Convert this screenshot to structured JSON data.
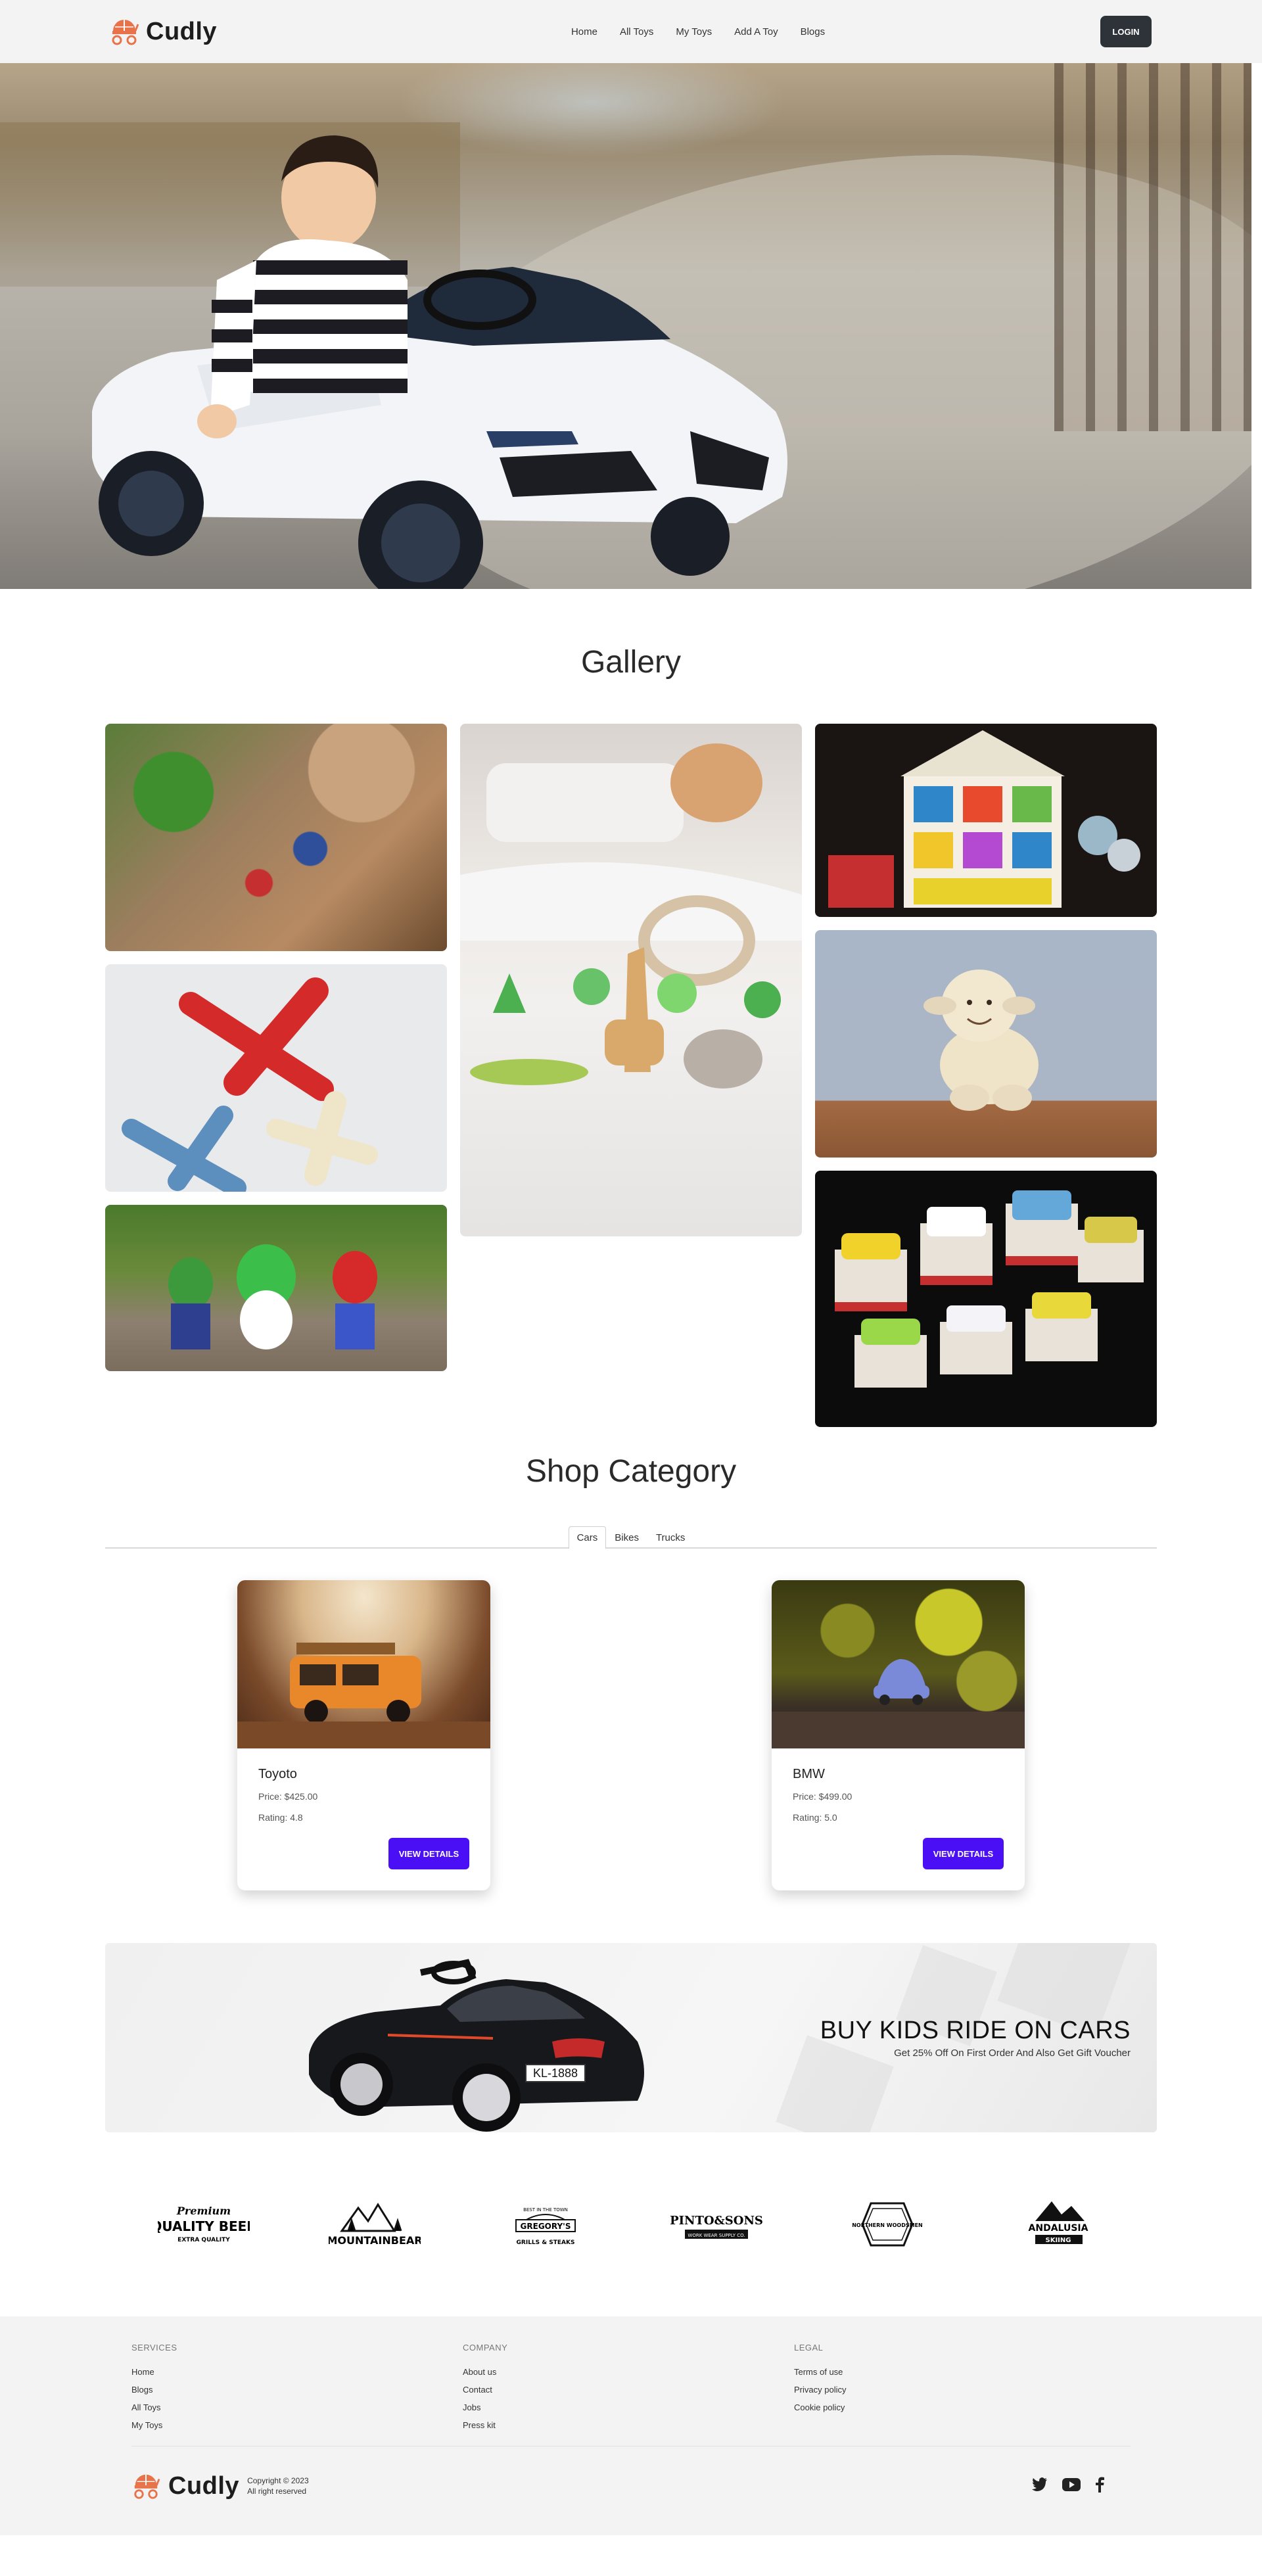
{
  "header": {
    "brand": "Cudly",
    "menu": [
      "Home",
      "All Toys",
      "My Toys",
      "Add A Toy",
      "Blogs"
    ],
    "login_label": "LOGIN"
  },
  "gallery": {
    "title": "Gallery"
  },
  "shop": {
    "title": "Shop Category",
    "tabs": [
      "Cars",
      "Bikes",
      "Trucks"
    ],
    "active_tab": "Cars",
    "products": [
      {
        "name": "Toyoto",
        "price": "Price: $425.00",
        "rating": "Rating: 4.8",
        "button": "VIEW DETAILS"
      },
      {
        "name": "BMW",
        "price": "Price: $499.00",
        "rating": "Rating: 5.0",
        "button": "VIEW DETAILS"
      }
    ]
  },
  "promo": {
    "title": "BUY KIDS RIDE ON CARS",
    "subtitle": "Get 25% Off On First Order And Also Get Gift Voucher",
    "plate": "KL-1888"
  },
  "partners": [
    {
      "line1": "Premium",
      "line2": "QUALITY BEER",
      "line3": "EXTRA QUALITY"
    },
    {
      "line1": "",
      "line2": "MOUNTAINBEAR",
      "line3": ""
    },
    {
      "line1": "BEST IN THE TOWN",
      "line2": "GREGORY'S",
      "line3": "GRILLS & STEAKS"
    },
    {
      "line1": "",
      "line2": "PINTO&SONS",
      "line3": "WORK WEAR SUPPLY CO."
    },
    {
      "line1": "",
      "line2": "NORTHERN WOODSMEN",
      "line3": ""
    },
    {
      "line1": "",
      "line2": "ANDALUSIA",
      "line3": "SKIING"
    }
  ],
  "footer": {
    "columns": [
      {
        "heading": "SERVICES",
        "links": [
          "Home",
          "Blogs",
          "All Toys",
          "My Toys"
        ]
      },
      {
        "heading": "COMPANY",
        "links": [
          "About us",
          "Contact",
          "Jobs",
          "Press kit"
        ]
      },
      {
        "heading": "LEGAL",
        "links": [
          "Terms of use",
          "Privacy policy",
          "Cookie policy"
        ]
      }
    ],
    "brand": "Cudly",
    "copyright": "Copyright © 2023",
    "rights": "All right reserved"
  },
  "colors": {
    "accent": "#4b0ff5",
    "login_bg": "#2d3339",
    "logo": "#e8734a"
  },
  "icons": [
    "stroller-logo-icon",
    "twitter-icon",
    "youtube-icon",
    "facebook-icon"
  ]
}
